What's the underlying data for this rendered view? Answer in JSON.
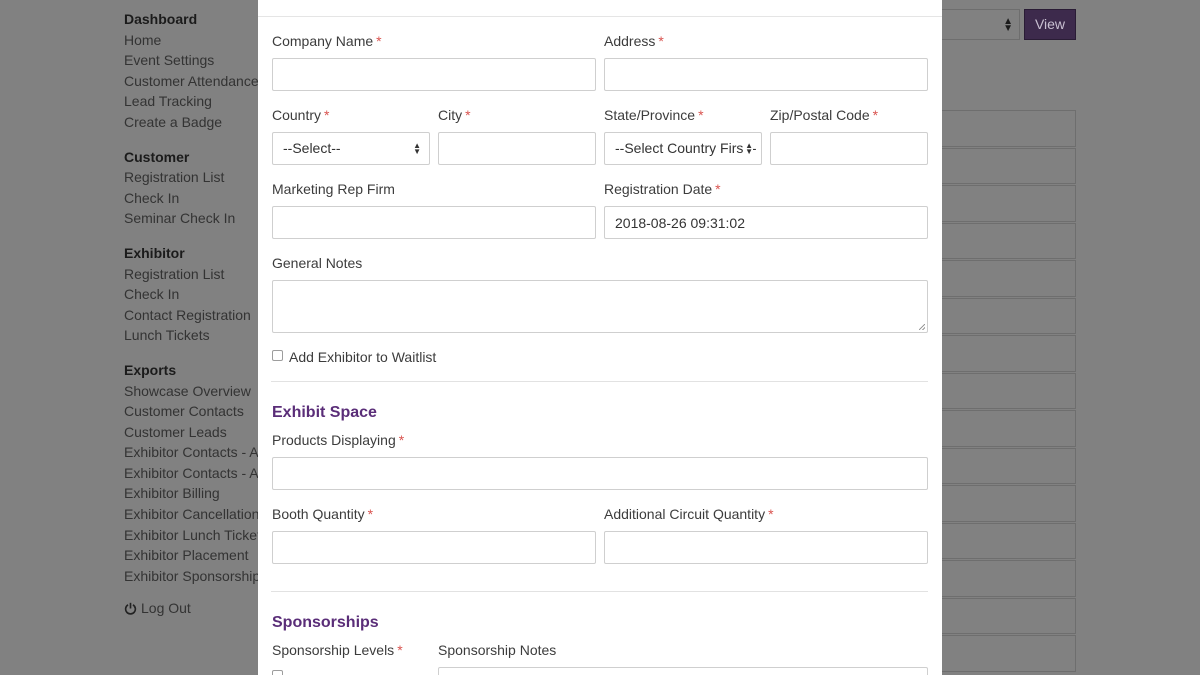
{
  "sidebar": {
    "groups": [
      {
        "title": "Dashboard",
        "items": [
          "Home",
          "Event Settings",
          "Customer Attendance",
          "Lead Tracking",
          "Create a Badge"
        ]
      },
      {
        "title": "Customer",
        "items": [
          "Registration List",
          "Check In",
          "Seminar Check In"
        ]
      },
      {
        "title": "Exhibitor",
        "items": [
          "Registration List",
          "Check In",
          "Contact Registration",
          "Lunch Tickets"
        ]
      },
      {
        "title": "Exports",
        "items": [
          "Showcase Overview",
          "Customer Contacts",
          "Customer Leads",
          "Exhibitor Contacts - All",
          "Exhibitor Contacts - At",
          "Exhibitor Billing",
          "Exhibitor Cancellations",
          "Exhibitor Lunch Tickets",
          "Exhibitor Placement",
          "Exhibitor Sponsorships"
        ]
      }
    ],
    "logout_label": "Log Out",
    "logout_icon": "power-icon"
  },
  "background": {
    "view_button": "View",
    "accent_color": "#5a2d78"
  },
  "form": {
    "company_name": {
      "label": "Company Name",
      "value": ""
    },
    "address": {
      "label": "Address",
      "value": ""
    },
    "country": {
      "label": "Country",
      "value": "--Select--"
    },
    "city": {
      "label": "City",
      "value": ""
    },
    "state": {
      "label": "State/Province",
      "value": "--Select Country First--"
    },
    "zip": {
      "label": "Zip/Postal Code",
      "value": ""
    },
    "marketing_rep": {
      "label": "Marketing Rep Firm",
      "value": ""
    },
    "registration_date": {
      "label": "Registration Date",
      "value": "2018-08-26 09:31:02"
    },
    "general_notes": {
      "label": "General Notes",
      "value": ""
    },
    "waitlist": {
      "label": "Add Exhibitor to Waitlist",
      "checked": false
    },
    "required_mark": "*"
  },
  "exhibit_space": {
    "title": "Exhibit Space",
    "products": {
      "label": "Products Displaying",
      "value": ""
    },
    "booth_quantity": {
      "label": "Booth Quantity",
      "value": ""
    },
    "circuit_quantity": {
      "label": "Additional Circuit Quantity",
      "value": ""
    }
  },
  "sponsorships": {
    "title": "Sponsorships",
    "levels": {
      "label": "Sponsorship Levels"
    },
    "notes": {
      "label": "Sponsorship Notes"
    }
  }
}
